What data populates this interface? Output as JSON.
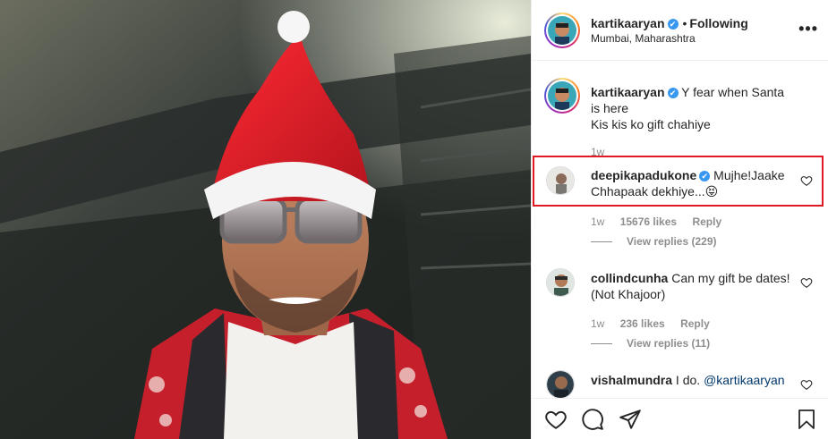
{
  "post": {
    "author": "kartikaaryan",
    "verified_mark": "✔",
    "follow_separator": "•",
    "follow_label": "Following",
    "location": "Mumbai, Maharashtra",
    "more_label": "•••"
  },
  "caption": {
    "username": "kartikaaryan",
    "line1": "Y fear when Santa is here",
    "line2": "Kis kis ko gift chahiye",
    "time": "1w"
  },
  "comments": [
    {
      "username": "deepikapadukone",
      "text": "Mujhe!Jaake Chhapaak dekhiye...😝",
      "time": "1w",
      "likes": "15676 likes",
      "reply": "Reply",
      "view_replies": "View replies (229)"
    },
    {
      "username": "collindcunha",
      "text": "Can my gift be dates! (Not Khajoor)",
      "time": "1w",
      "likes": "236 likes",
      "reply": "Reply",
      "view_replies": "View replies (11)"
    },
    {
      "username": "vishalmundra",
      "text": "I do.",
      "mention": "@kartikaaryan"
    }
  ],
  "icons": {
    "like": "heart-icon",
    "comment": "comment-icon",
    "share": "share-icon",
    "save": "bookmark-icon",
    "more": "more-options-icon"
  },
  "colors": {
    "highlight": "#e01a22",
    "verified": "#3897f0",
    "santa_hat": "#d8202a"
  }
}
